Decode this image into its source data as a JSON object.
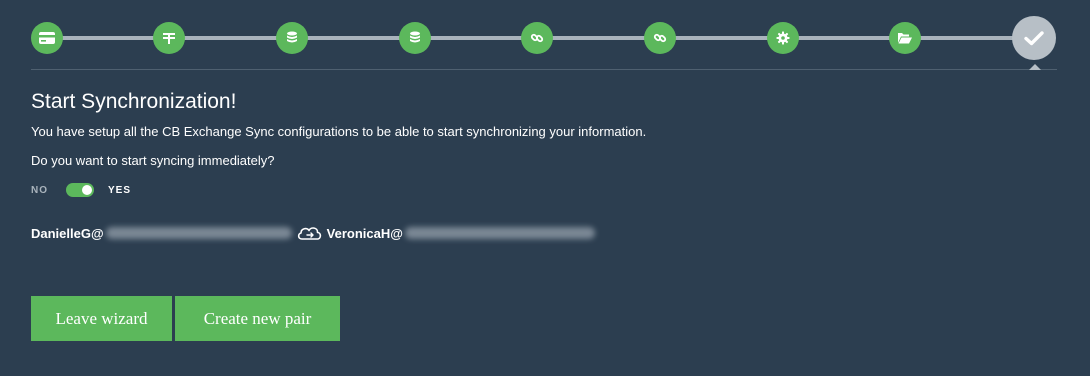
{
  "stepper": {
    "steps": [
      {
        "icon": "credit-card-icon",
        "state": "complete"
      },
      {
        "icon": "columns-icon",
        "state": "complete"
      },
      {
        "icon": "database-icon",
        "state": "complete"
      },
      {
        "icon": "database-icon",
        "state": "complete"
      },
      {
        "icon": "link-icon",
        "state": "complete"
      },
      {
        "icon": "link-icon",
        "state": "complete"
      },
      {
        "icon": "gear-icon",
        "state": "complete"
      },
      {
        "icon": "folder-open-icon",
        "state": "complete"
      },
      {
        "icon": "check-icon",
        "state": "current"
      }
    ]
  },
  "content": {
    "title": "Start Synchronization!",
    "description": "You have setup all the CB Exchange Sync configurations to be able to start synchronizing your information.",
    "question": "Do you want to start syncing immediately?"
  },
  "toggle": {
    "no_label": "NO",
    "yes_label": "YES",
    "value": "YES"
  },
  "pair": {
    "source_user": "DanielleG@",
    "target_user": "VeronicaH@",
    "sync_icon": "cloud-sync-icon"
  },
  "buttons": {
    "leave_label": "Leave wizard",
    "create_label": "Create new pair"
  },
  "colors": {
    "background": "#2c3e50",
    "accent": "#5cb85c",
    "track": "#a9b3bc",
    "current_step": "#b7bfc6"
  }
}
